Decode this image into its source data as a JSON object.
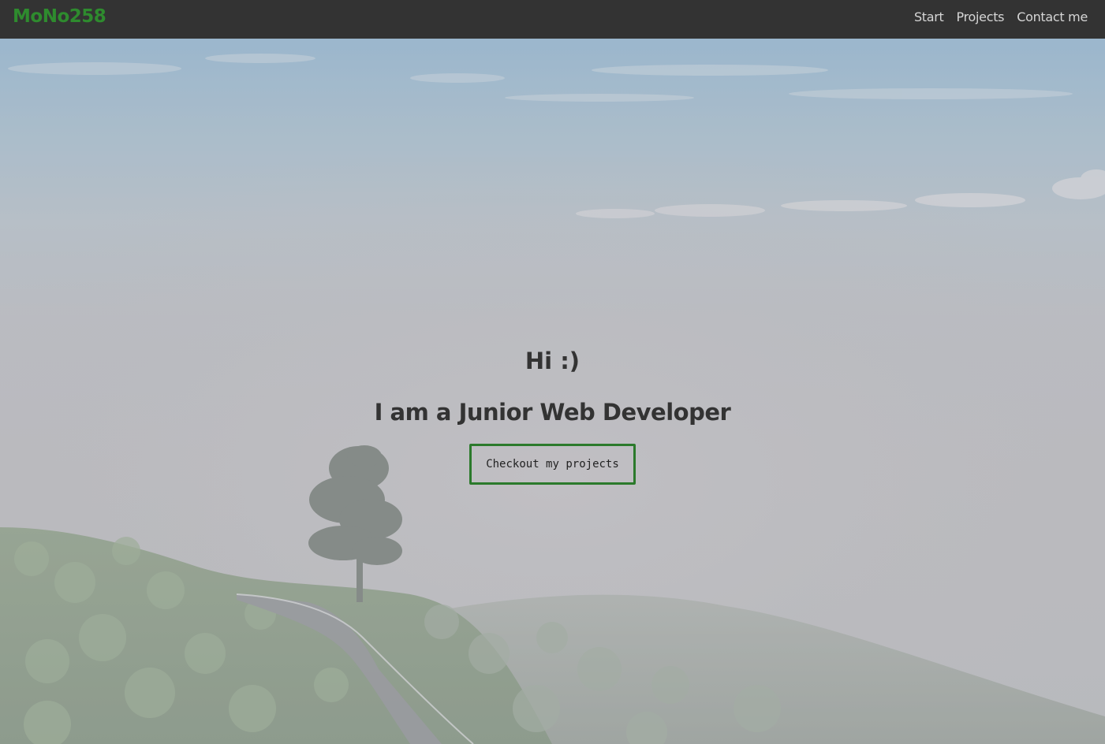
{
  "navbar": {
    "brand": "MoNo258",
    "links": [
      {
        "label": "Start"
      },
      {
        "label": "Projects"
      },
      {
        "label": "Contact me"
      }
    ]
  },
  "hero": {
    "greeting": "Hi :)",
    "tagline": "I am a Junior Web Developer",
    "cta_label": "Checkout my projects",
    "background": "misty-hillside-with-tree-photo"
  },
  "colors": {
    "navbar_bg": "#333333",
    "brand": "#2e8b2e",
    "nav_link": "#d6d6d6",
    "heading": "#333333",
    "cta_border": "#2b7a2b"
  }
}
